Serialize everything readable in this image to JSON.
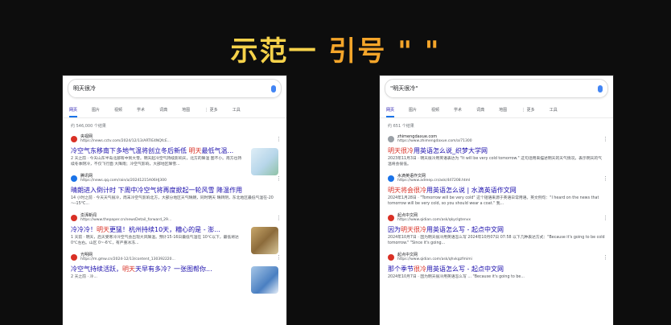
{
  "header": {
    "title_a": "示范一",
    "title_b": " 引号 \" \""
  },
  "panel_left": {
    "query": "明天很冷",
    "tabs": [
      "网页",
      "图片",
      "视频",
      "学术",
      "词典",
      "地图",
      "⋮ 更多",
      "工具"
    ],
    "count": "约 546,000 个结果",
    "results": [
      {
        "site": "央视网",
        "url": "https://news.cctv.com/2024/12/13/ARTIE4NQfcE...",
        "title_pre": "冷空气东移南下多地气温将创立冬后新低 ",
        "title_hl": "明天",
        "title_post": "最低气温...",
        "snippet": "2 天之前 · 今天山东半岛北部有中到大雪。明天起冷空气持续影响天，北方的降温 图不小。南方也持续冬季阴冷，不仅飞行面 大降雨；冷空气影响，大部地区降雪..."
      },
      {
        "site": "腾讯网",
        "url": "https://news.qq.com/rain/a/20241215A06HJ300",
        "title_pre": "晴朗进入倒计时 下周中冷空气将再度掀起一轮风雪 降温作用",
        "title_hl": "",
        "title_post": "",
        "snippet": "14 小时之前 · 今天天气很冷，周末冷空气影响北方，大部分地区天气晴朗，同时明天 晴转阴，东北地区最低气温在-20～-15°C..."
      },
      {
        "site": "澎湃新闻",
        "url": "https://www.thepaper.cn/newsDetail_forward_29...",
        "title_pre": "冷冷冷！",
        "title_hl": "明天",
        "title_post": "更猛！杭州持续10天，糟心的是 - 澎...",
        "snippet": "1 天前 · 明天，后天受寒冷冷空气会出现大风降温。预计15-16日最低气温在 10℃以下，最低将达0℃左右。山区 0~-6℃，有严重冰冻..."
      },
      {
        "site": "光明网",
        "url": "https://m.gmw.cn/2024-12/13/content_130392220...",
        "title_pre": "冷空气持续活跃，",
        "title_hl": "明天",
        "title_post": "天早有多冷？一张图帮你...",
        "snippet": "2 天之前 · 冷..."
      }
    ]
  },
  "panel_right": {
    "query": "\"明天很冷\"",
    "tabs": [
      "网页",
      "图片",
      "视频",
      "学术",
      "词典",
      "地图",
      "⋮ 更多",
      "工具"
    ],
    "count": "约 651 个结果",
    "results": [
      {
        "site": "zhimengdaxue.com",
        "url": "https://www.zhimengdaxue.com/a/71300",
        "title_pre": "明天很冷",
        "title_hl": "",
        "title_post": "用英语怎么说_织梦大学网",
        "snippet": "2023年11月3日 · 明天很冷用英语表达为 \"It will be very cold tomorrow.\" 这句话用来描述明天的天气情况，表示明天的气温将会很低。"
      },
      {
        "site": "水滴英语作文网",
        "url": "https://www.adreep.cn/ask/447208.html",
        "title_pre": "明天将会很冷",
        "title_hl": "",
        "title_post": "用英语怎么说 | 水滴英语作文网",
        "snippet": "2024年1月28日 · \"Tomorrow will be very cold\" 这个短语来源于英语日常用语。英文例句：\"I heard on the news that tomorrow will be very cold, so you should wear a coat.\" 我..."
      },
      {
        "site": "起点中文网",
        "url": "https://www.qidian.com/ask/qkyclgtenvx",
        "title_pre": "因为",
        "title_hl": "明天很冷",
        "title_post": "用英语怎么写 - 起点中文网",
        "snippet": "2024年10月7日 · 因为明天很冷用英语怎么写 2024年10月07日 07:58 以下几种表达方式：\"Because it's going to be cold tomorrow.\" \"Since it's going..."
      },
      {
        "site": "起点中文网",
        "url": "https://www.qidian.com/ask/qhvkgzfmimi",
        "title_pre": "那个季节",
        "title_hl": "很冷",
        "title_post": "用英语怎么写 - 起点中文网",
        "snippet": "2024年10月7日 · 因为明天很冷用英语怎么写 ... \"Because it's going to be..."
      }
    ]
  }
}
